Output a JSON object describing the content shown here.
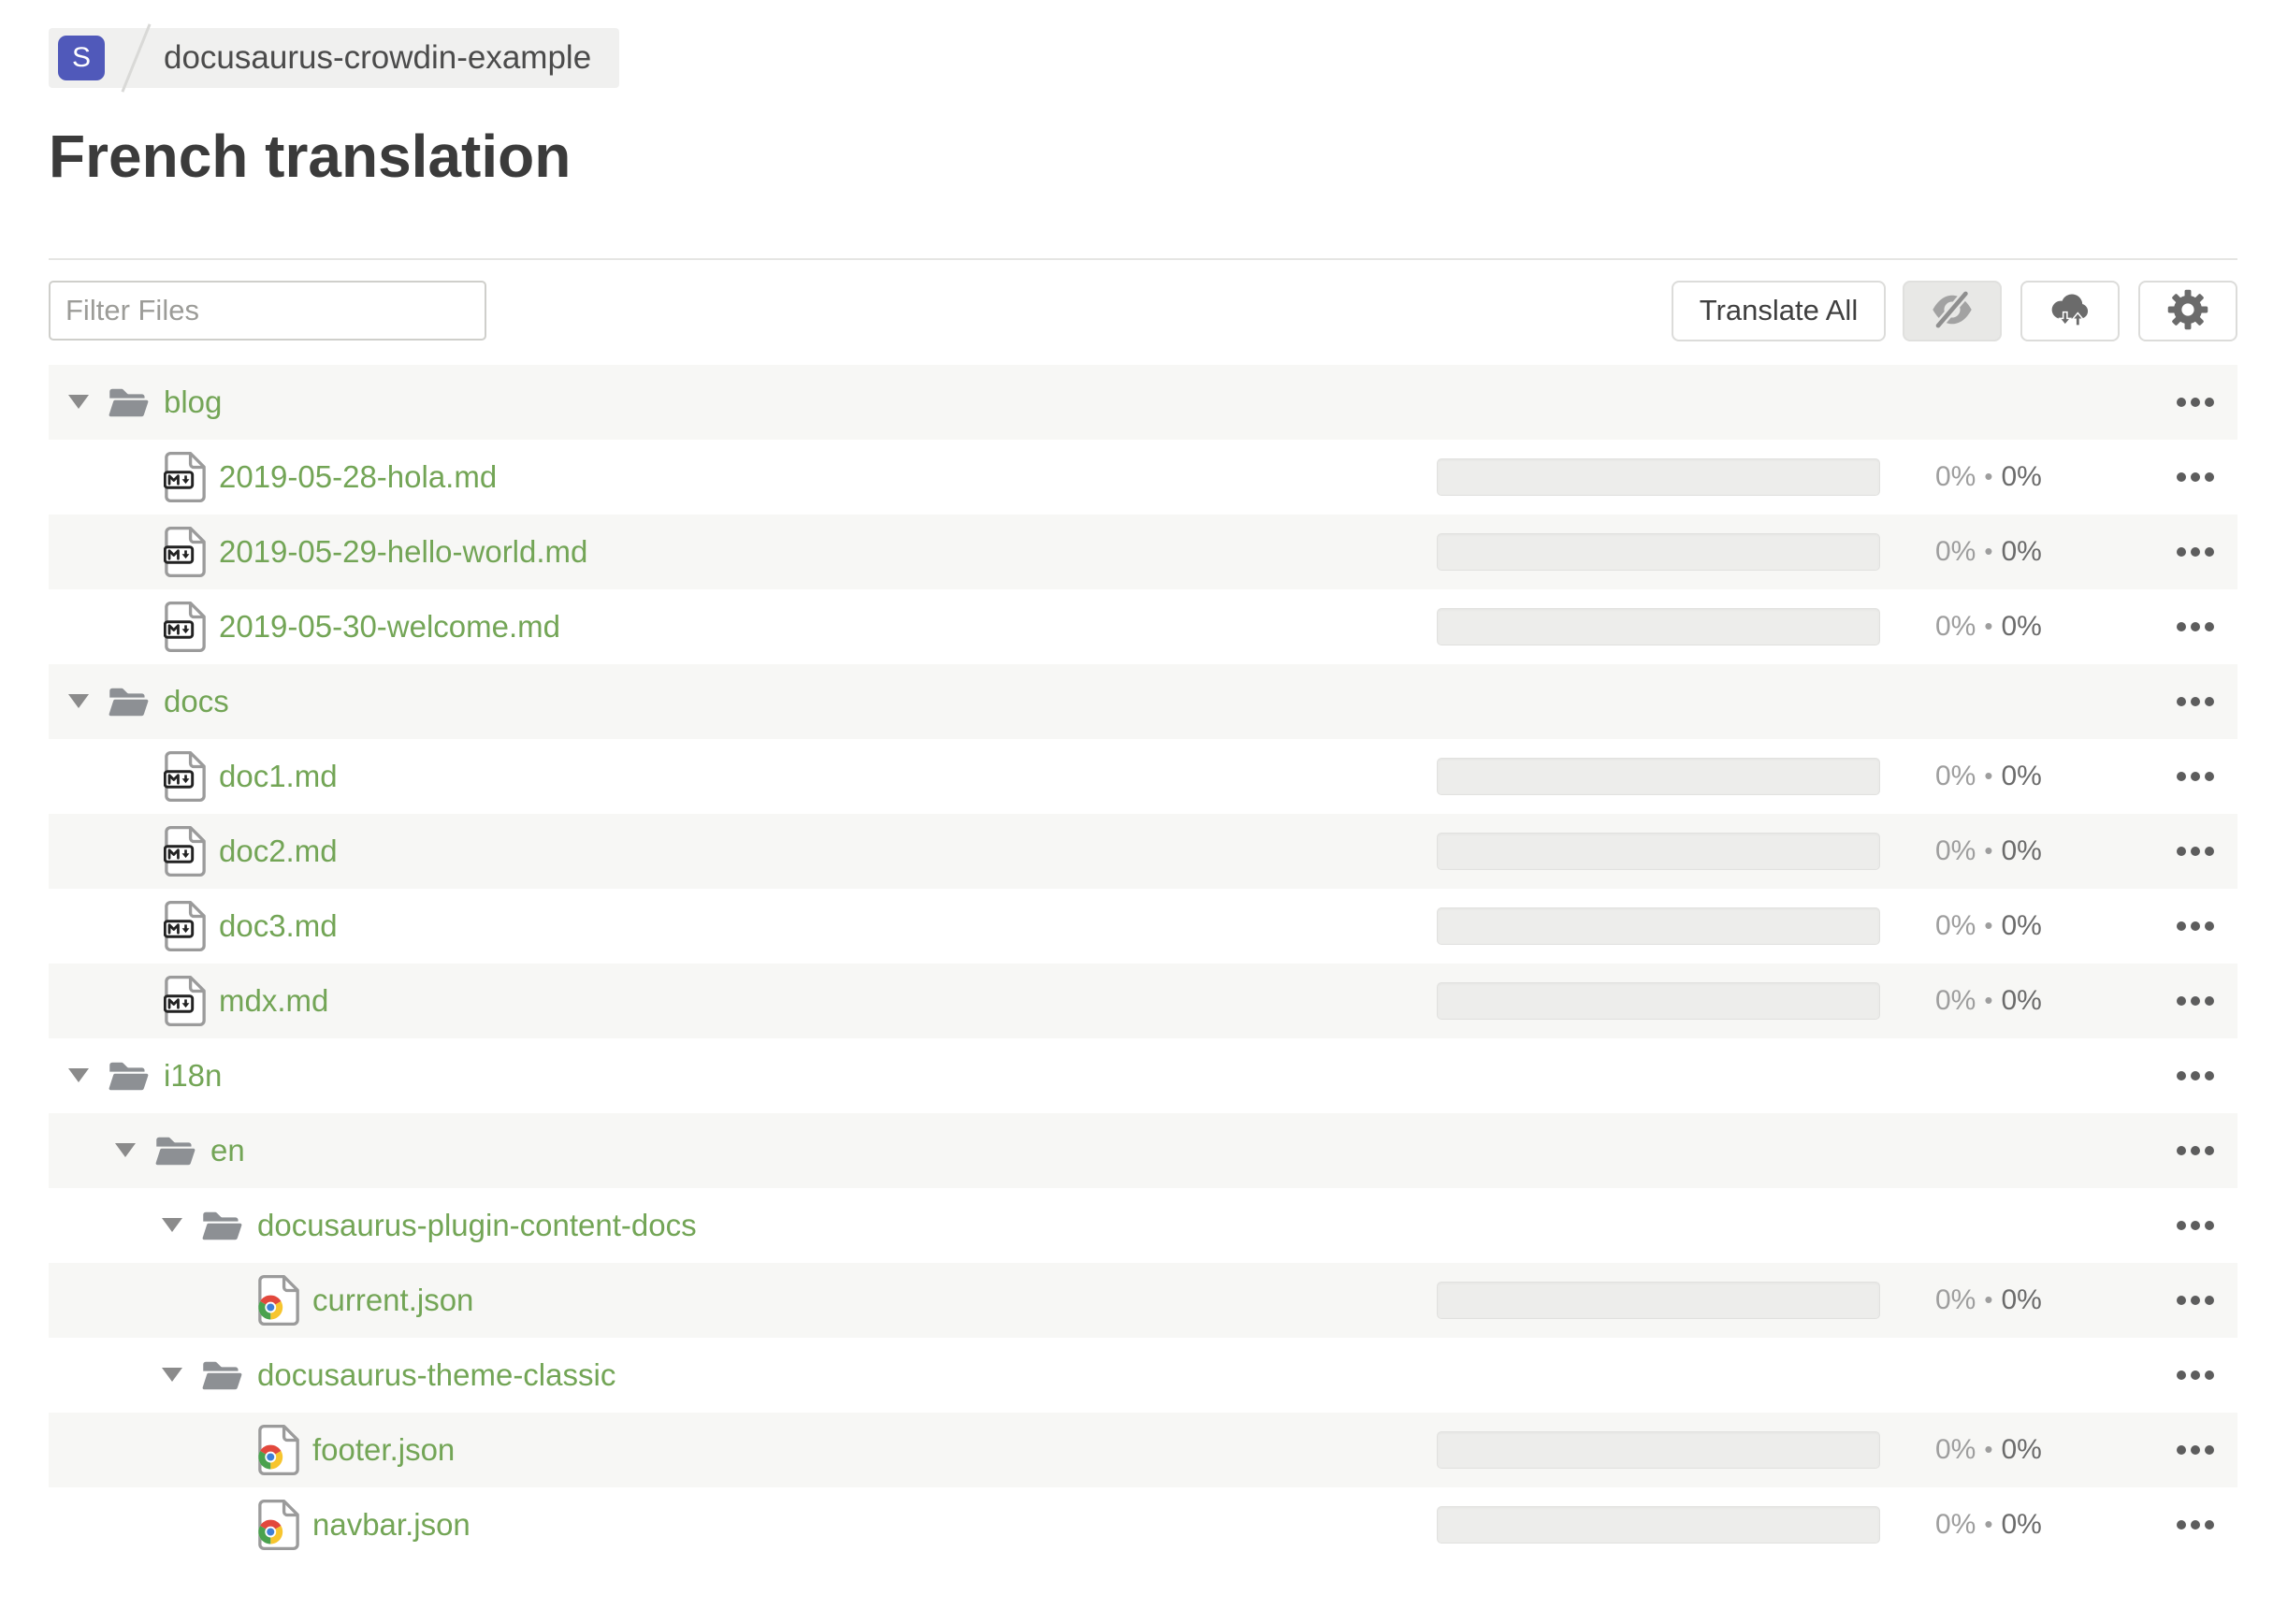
{
  "breadcrumb": {
    "avatar_letter": "S",
    "avatar_icon": "project-letter-badge",
    "project_name": "docusaurus-crowdin-example"
  },
  "page": {
    "title": "French translation"
  },
  "toolbar": {
    "filter_placeholder": "Filter Files",
    "translate_all_label": "Translate All",
    "icon_buttons": [
      {
        "name": "toggle-hidden-files",
        "icon": "eye-slash-icon",
        "pressed": true
      },
      {
        "name": "sync-translations",
        "icon": "cloud-download-upload-icon",
        "pressed": false
      },
      {
        "name": "settings",
        "icon": "gear-icon",
        "pressed": false
      }
    ]
  },
  "tree": {
    "progress_separator": "•",
    "rows": [
      {
        "type": "folder",
        "name": "blog",
        "level": 0,
        "expanded": true
      },
      {
        "type": "file",
        "kind": "md",
        "name": "2019-05-28-hola.md",
        "level": 1,
        "translated": "0%",
        "approved": "0%"
      },
      {
        "type": "file",
        "kind": "md",
        "name": "2019-05-29-hello-world.md",
        "level": 1,
        "translated": "0%",
        "approved": "0%"
      },
      {
        "type": "file",
        "kind": "md",
        "name": "2019-05-30-welcome.md",
        "level": 1,
        "translated": "0%",
        "approved": "0%"
      },
      {
        "type": "folder",
        "name": "docs",
        "level": 0,
        "expanded": true
      },
      {
        "type": "file",
        "kind": "md",
        "name": "doc1.md",
        "level": 1,
        "translated": "0%",
        "approved": "0%"
      },
      {
        "type": "file",
        "kind": "md",
        "name": "doc2.md",
        "level": 1,
        "translated": "0%",
        "approved": "0%"
      },
      {
        "type": "file",
        "kind": "md",
        "name": "doc3.md",
        "level": 1,
        "translated": "0%",
        "approved": "0%"
      },
      {
        "type": "file",
        "kind": "md",
        "name": "mdx.md",
        "level": 1,
        "translated": "0%",
        "approved": "0%"
      },
      {
        "type": "folder",
        "name": "i18n",
        "level": 0,
        "expanded": true
      },
      {
        "type": "folder",
        "name": "en",
        "level": 1,
        "expanded": true
      },
      {
        "type": "folder",
        "name": "docusaurus-plugin-content-docs",
        "level": 2,
        "expanded": true
      },
      {
        "type": "file",
        "kind": "json",
        "name": "current.json",
        "level": 3,
        "translated": "0%",
        "approved": "0%"
      },
      {
        "type": "folder",
        "name": "docusaurus-theme-classic",
        "level": 2,
        "expanded": true
      },
      {
        "type": "file",
        "kind": "json",
        "name": "footer.json",
        "level": 3,
        "translated": "0%",
        "approved": "0%"
      },
      {
        "type": "file",
        "kind": "json",
        "name": "navbar.json",
        "level": 3,
        "translated": "0%",
        "approved": "0%"
      }
    ],
    "icons": {
      "folder": "folder-open-icon",
      "caret": "caret-down-icon",
      "md": "markdown-file-icon",
      "json": "json-chrome-file-icon",
      "menu": "ellipsis-icon"
    }
  },
  "colors": {
    "link_green": "#73a556",
    "avatar_bg": "#5059ba",
    "crumb_bg": "#f0f0ef",
    "row_shade": "#f7f7f5",
    "bar_bg": "#ededeb",
    "pct_light": "#9e9e9e",
    "pct_dark": "#6b6b6b"
  }
}
